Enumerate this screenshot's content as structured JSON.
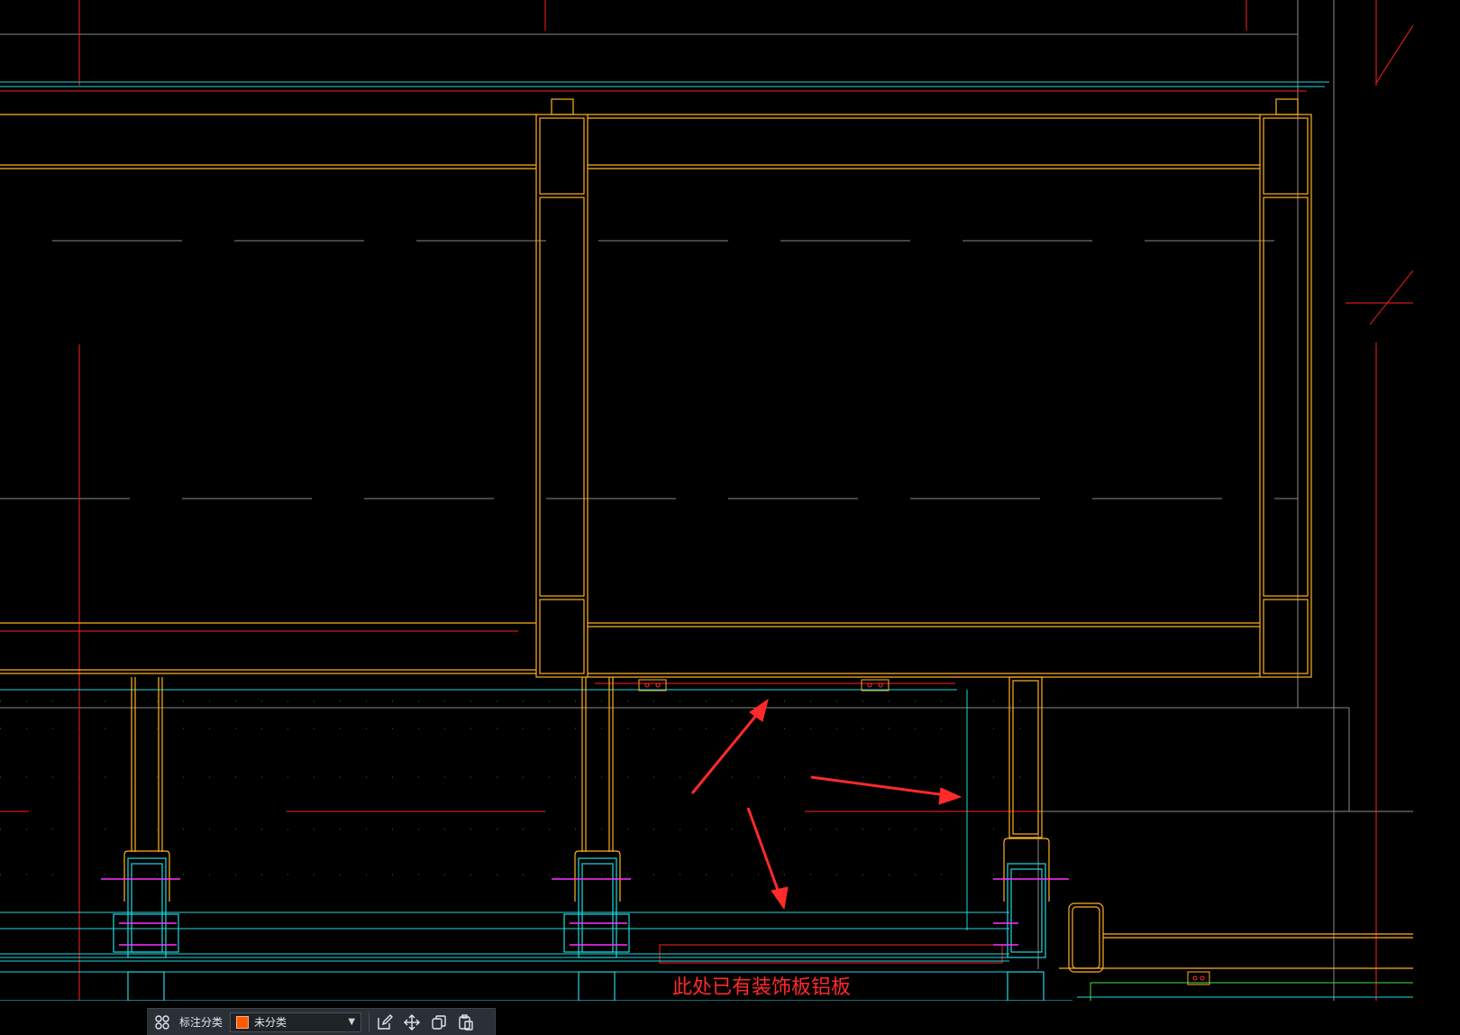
{
  "annotation": {
    "text": "此处已有装饰板铝板"
  },
  "toolbar": {
    "category_label": "标注分类",
    "category_value": "未分类",
    "swatch_color": "#ff5a00",
    "icons": [
      "grid-icon",
      "edit-icon",
      "move-icon",
      "copy-icon",
      "paste-icon"
    ]
  },
  "colors": {
    "background": "#000000",
    "frame": "#ffb020",
    "cyan": "#20d8e0",
    "red": "#ff2020",
    "grey": "#9a9a9a",
    "magenta": "#ff30ff",
    "arrow": "#ff2a2a"
  }
}
